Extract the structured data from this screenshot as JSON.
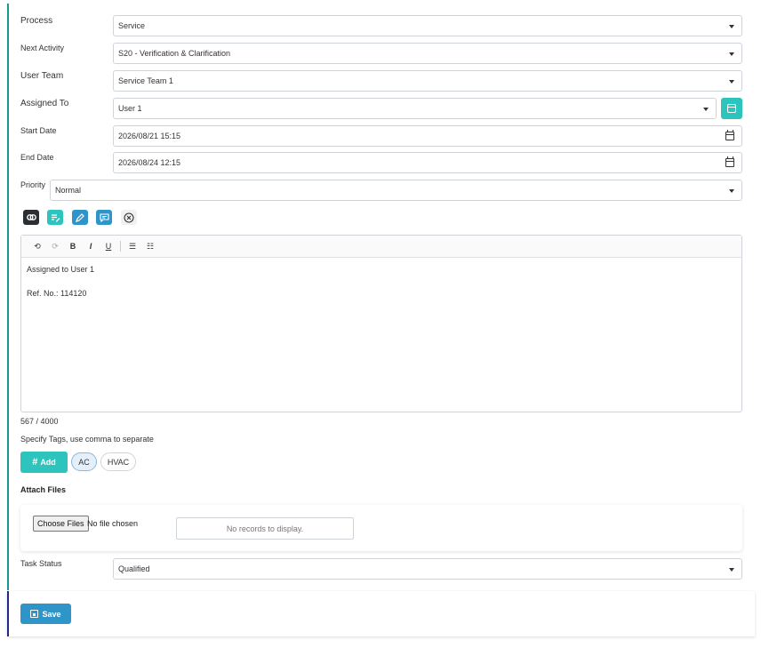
{
  "form": {
    "process": {
      "label": "Process",
      "value": "Service"
    },
    "next_activity": {
      "label": "Next Activity",
      "value": "S20 - Verification & Clarification"
    },
    "user_team": {
      "label": "User Team",
      "value": "Service Team 1"
    },
    "assigned_to": {
      "label": "Assigned To",
      "value": "User 1"
    },
    "start_date": {
      "label": "Start Date",
      "value": "2026/08/21 15:15"
    },
    "end_date": {
      "label": "End Date",
      "value": "2026/08/24 12:15"
    },
    "priority": {
      "label": "Priority",
      "value": "Normal"
    },
    "task_status": {
      "label": "Task Status",
      "value": "Qualified"
    }
  },
  "quick_actions": {
    "icons": [
      "link-icon",
      "note-edit-icon",
      "pencil-icon",
      "comment-icon",
      "clear-icon"
    ],
    "colors": [
      "#2b2f33",
      "#2cc4bd",
      "#2f95c9",
      "#2f95c9",
      "#ffffff"
    ]
  },
  "editor": {
    "toolbar": {
      "undo": "⟲",
      "redo": "⟳",
      "bold": "B",
      "italic": "I",
      "underline": "U",
      "bullet_list": "☰",
      "numbered_list": "☷"
    },
    "content": {
      "line1": "Assigned to User 1",
      "line2": "Ref. No.: 114120"
    },
    "counter": "567 / 4000"
  },
  "tags": {
    "hint": "Specify Tags, use comma to separate",
    "add_label": "Add",
    "add_icon": "#",
    "items": [
      "AC",
      "HVAC"
    ]
  },
  "attachments": {
    "title": "Attach Files",
    "choose_label": "Choose Files",
    "no_file": "No file chosen",
    "empty_records": "No records to display."
  },
  "footer": {
    "save_label": "Save"
  },
  "colors": {
    "accent_teal": "#2cc4bd",
    "accent_blue": "#2f95c9",
    "panel_border": "#17998f"
  }
}
